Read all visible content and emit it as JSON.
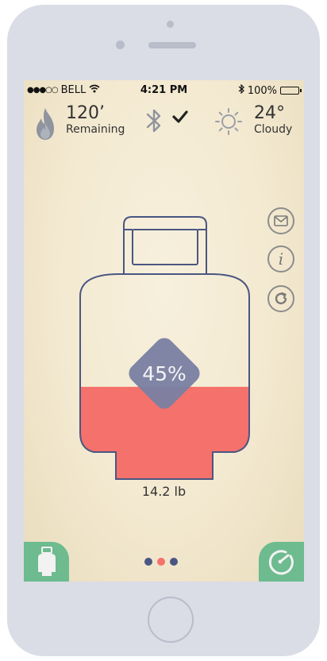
{
  "status_bar": {
    "signal_dots": "●●●○○",
    "carrier": "BELL",
    "time": "4:21 PM",
    "battery": "100%",
    "battery_level": 1.0
  },
  "gas": {
    "value": "120’",
    "label": "Remaining"
  },
  "bluetooth": {
    "icon": "bluetooth-icon",
    "connected_icon": "checkmark-icon"
  },
  "weather": {
    "temp": "24°",
    "condition": "Cloudy",
    "icon": "sun-icon"
  },
  "actions": [
    {
      "name": "email",
      "icon": "envelope-icon"
    },
    {
      "name": "info",
      "icon": "info-icon",
      "glyph": "i"
    },
    {
      "name": "refresh",
      "icon": "refresh-icon"
    }
  ],
  "tank": {
    "fill_percent_label": "45%",
    "fill_fraction": 0.45,
    "weight": "14.2 lb"
  },
  "pager": {
    "count": 3,
    "active_index": 1
  },
  "colors": {
    "fill": "#f5716b",
    "outline": "#4a5682",
    "badge": "#7b80a2",
    "tab": "#6dbb8e",
    "dot_inactive": "#4a5682",
    "dot_active": "#f5716b"
  }
}
